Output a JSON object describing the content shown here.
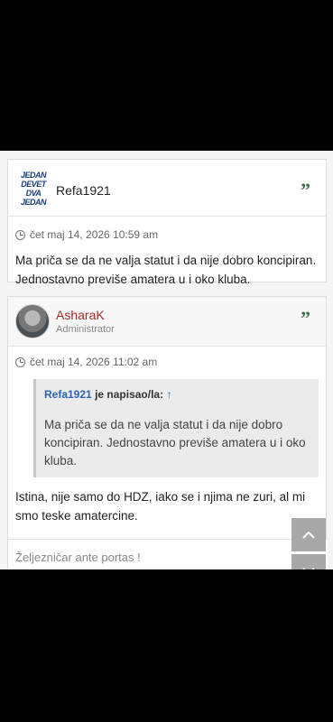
{
  "posts": [
    {
      "author": "Refa1921",
      "avatar_logo_lines": [
        "JEDAN",
        "DEVET",
        "DVA",
        "JEDAN"
      ],
      "date": "čet maj 14, 2026 10:59 am",
      "text": "Ma priča se da ne valja statut i da nije dobro koncipiran. Jednostavno previše amatera u i oko kluba."
    },
    {
      "author": "AsharaK",
      "role": "Administrator",
      "date": "čet maj 14, 2026 11:02 am",
      "quote": {
        "author": "Refa1921",
        "wrote": "je napisao/la:",
        "arrow": "↑",
        "text": "Ma priča se da ne valja statut i da nije dobro koncipiran. Jednostavno previše amatera u i oko kluba."
      },
      "text": "Istina, nije samo do HDZ, iako se i njima ne zuri, al mi smo teske amatercine.",
      "signature": "Željezničar ante portas !"
    }
  ],
  "icons": {
    "quote": "quote-icon",
    "clock": "clock-icon",
    "scroll_up": "chevron-up-icon",
    "scroll_down": "chevron-down-icon"
  },
  "colors": {
    "admin_name": "#a52a2a",
    "quote_link": "#2e62b5",
    "quote_icon": "#3f6e4e"
  }
}
